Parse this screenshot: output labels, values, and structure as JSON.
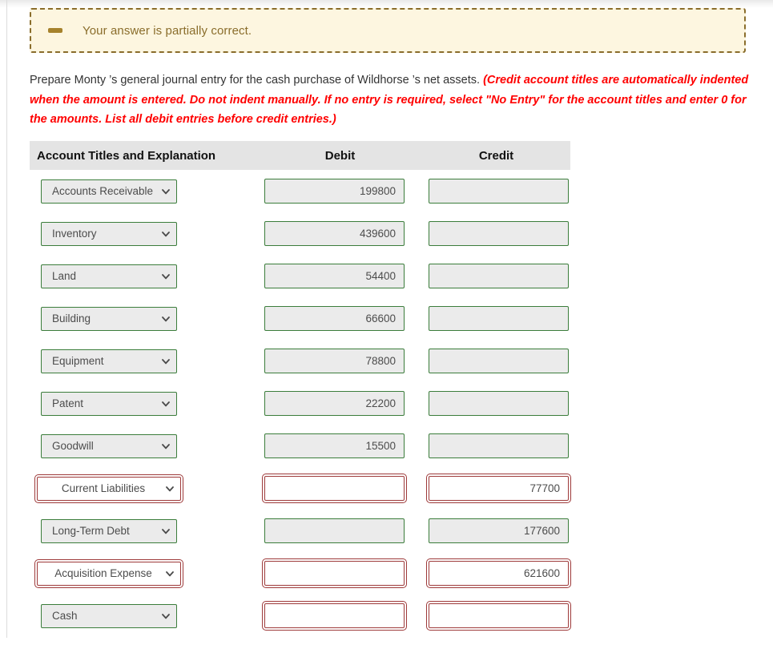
{
  "banner": {
    "icon": "minus-bar-icon",
    "message": "Your answer is partially correct."
  },
  "instructions": {
    "lead": "Prepare Monty ’s general journal entry for the cash purchase of Wildhorse ’s net assets. ",
    "hint": "(Credit account titles are automatically indented when the amount is entered. Do not indent manually. If no entry is required, select \"No Entry\" for the account titles and enter 0 for the amounts. List all debit entries before credit entries.)"
  },
  "table": {
    "headers": {
      "account": "Account Titles and Explanation",
      "debit": "Debit",
      "credit": "Credit"
    },
    "rows": [
      {
        "account": "Accounts Receivable",
        "account_state": "correct",
        "debit": "199800",
        "debit_state": "correct",
        "credit": "",
        "credit_state": "correct"
      },
      {
        "account": "Inventory",
        "account_state": "correct",
        "debit": "439600",
        "debit_state": "correct",
        "credit": "",
        "credit_state": "correct"
      },
      {
        "account": "Land",
        "account_state": "correct",
        "debit": "54400",
        "debit_state": "correct",
        "credit": "",
        "credit_state": "correct"
      },
      {
        "account": "Building",
        "account_state": "correct",
        "debit": "66600",
        "debit_state": "correct",
        "credit": "",
        "credit_state": "correct"
      },
      {
        "account": "Equipment",
        "account_state": "correct",
        "debit": "78800",
        "debit_state": "correct",
        "credit": "",
        "credit_state": "correct"
      },
      {
        "account": "Patent",
        "account_state": "correct",
        "debit": "22200",
        "debit_state": "correct",
        "credit": "",
        "credit_state": "correct"
      },
      {
        "account": "Goodwill",
        "account_state": "correct",
        "debit": "15500",
        "debit_state": "correct",
        "credit": "",
        "credit_state": "correct"
      },
      {
        "account": "Current Liabilities",
        "account_state": "error",
        "debit": "",
        "debit_state": "error",
        "credit": "77700",
        "credit_state": "error"
      },
      {
        "account": "Long-Term Debt",
        "account_state": "correct",
        "debit": "",
        "debit_state": "correct",
        "credit": "177600",
        "credit_state": "correct"
      },
      {
        "account": "Acquisition Expense",
        "account_state": "error",
        "debit": "",
        "debit_state": "error",
        "credit": "621600",
        "credit_state": "error"
      },
      {
        "account": "Cash",
        "account_state": "correct",
        "debit": "",
        "debit_state": "error",
        "credit": "",
        "credit_state": "error"
      }
    ]
  },
  "colors": {
    "correct_border": "#3b7d3b",
    "error_border": "#9e3a3a",
    "banner_bg": "#fdf6e0",
    "banner_border": "#8a6d2b",
    "banner_text": "#8a6d2b",
    "hint_text": "#ff0000",
    "header_bg": "#e4e4e4",
    "field_bg": "#ebebeb"
  }
}
